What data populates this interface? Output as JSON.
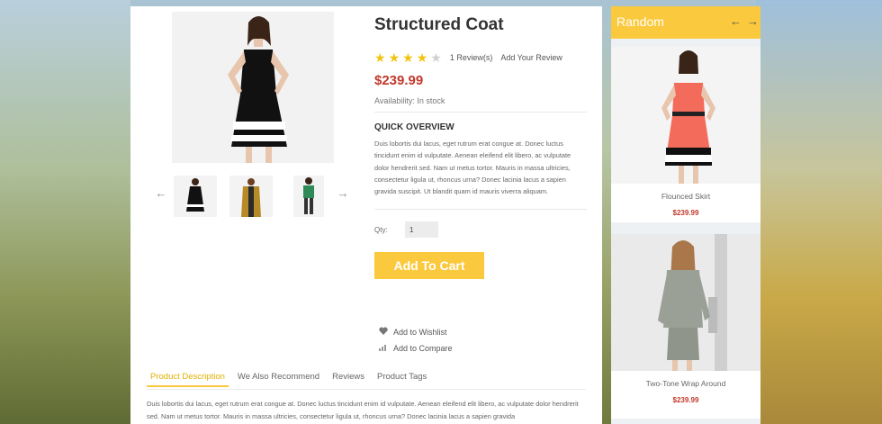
{
  "product": {
    "title": "Structured Coat",
    "rating": 4,
    "rating_max": 5,
    "reviews_count": "1 Review(s)",
    "add_review": "Add Your Review",
    "price": "$239.99",
    "availability": "Availability: In stock",
    "quick_overview_title": "QUICK OVERVIEW",
    "quick_overview_text": "Duis lobortis dui lacus, eget rutrum erat congue at. Donec luctus tincidunt enim id vulputate. Aenean eleifend elit libero, ac vulputate dolor hendrerit sed. Nam ut metus tortor. Mauris in massa ultricies, consectetur ligula ut, rhoncus urna? Donec lacinia lacus a sapien gravida suscipit. Ut blandit quam id mauris viverra aliquam.",
    "qty_label": "Qty:",
    "qty_value": "1",
    "add_to_cart": "Add To Cart",
    "wishlist": "Add to Wishlist",
    "compare": "Add to Compare"
  },
  "tabs": [
    {
      "label": "Product Description",
      "active": true
    },
    {
      "label": "We Also Recommend",
      "active": false
    },
    {
      "label": "Reviews",
      "active": false
    },
    {
      "label": "Product Tags",
      "active": false
    }
  ],
  "description": "Duis lobortis dui lacus, eget rutrum erat congue at. Donec luctus tincidunt enim id vulputate. Aenean eleifend elit libero, ac vulputate dolor hendrerit sed. Nam ut metus tortor. Mauris in massa ultricies, consectetur ligula ut, rhoncus urna? Donec lacinia lacus a sapien gravida",
  "sidebar": {
    "title": "Random",
    "items": [
      {
        "name": "Flounced Skirt",
        "price": "$239.99"
      },
      {
        "name": "Two-Tone Wrap Around",
        "price": "$239.99"
      }
    ]
  },
  "colors": {
    "accent": "#fbc93d",
    "price": "#c0392b",
    "star": "#f1c40f"
  },
  "icons": {
    "prev": "arrow-left-icon",
    "next": "arrow-right-icon",
    "wishlist": "heart-icon",
    "compare": "bar-chart-icon"
  }
}
